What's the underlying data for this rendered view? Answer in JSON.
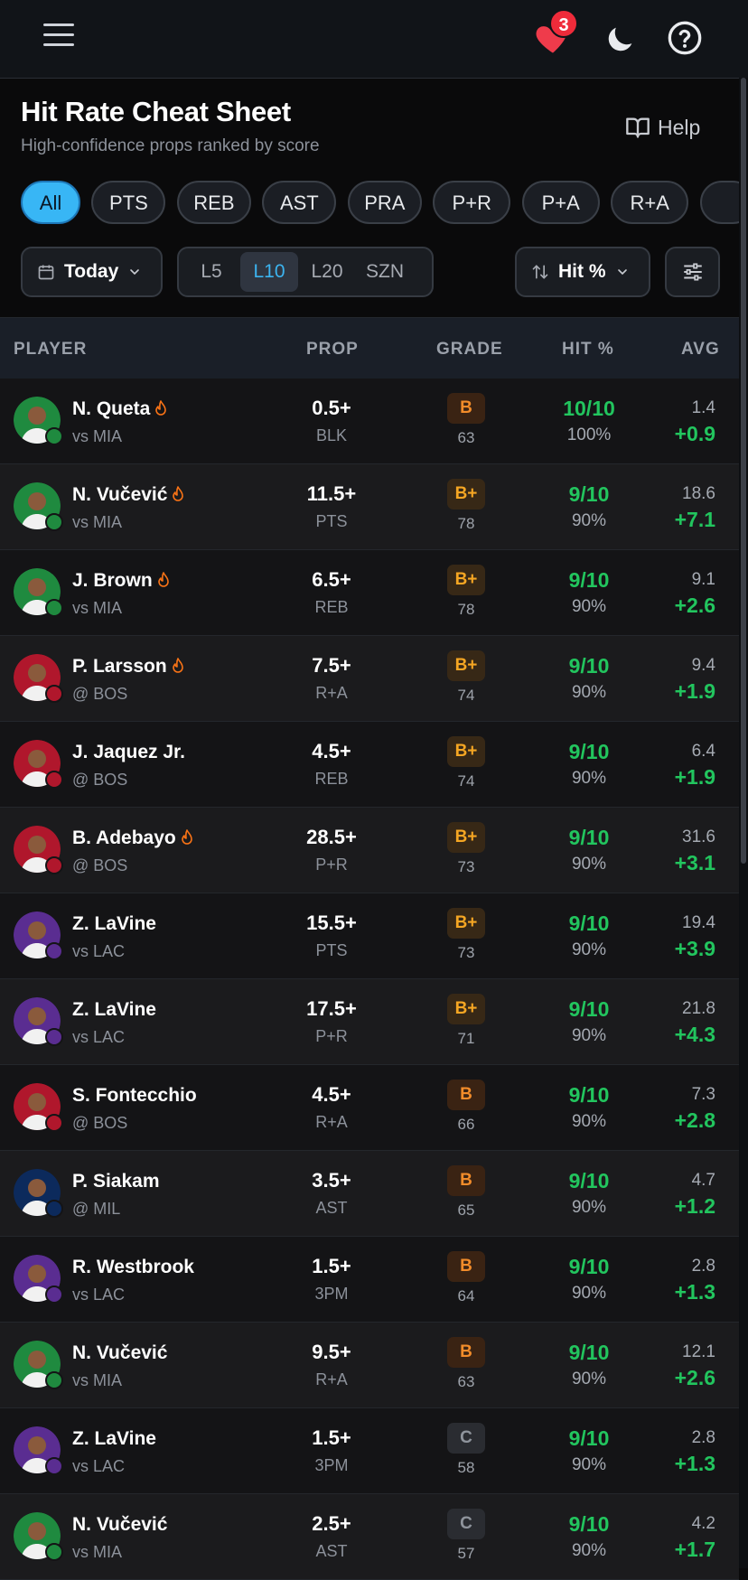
{
  "topbar": {
    "menu_icon": "hamburger-menu-icon",
    "favorites_icon": "heart-icon",
    "favorites_count": "3",
    "theme_icon": "moon-icon",
    "help_icon": "question-circle-icon"
  },
  "header": {
    "title": "Hit Rate Cheat Sheet",
    "subtitle": "High-confidence props ranked by score",
    "help_label": "Help"
  },
  "chips": [
    {
      "label": "All",
      "active": true
    },
    {
      "label": "PTS"
    },
    {
      "label": "REB"
    },
    {
      "label": "AST"
    },
    {
      "label": "PRA"
    },
    {
      "label": "P+R"
    },
    {
      "label": "P+A"
    },
    {
      "label": "R+A"
    }
  ],
  "controls": {
    "date_label": "Today",
    "windows": [
      "L5",
      "L10",
      "L20",
      "SZN"
    ],
    "active_window": "L10",
    "sort_label": "Hit %"
  },
  "table": {
    "headers": {
      "player": "PLAYER",
      "prop": "PROP",
      "grade": "GRADE",
      "hit": "HIT %",
      "avg": "AVG"
    },
    "rows": [
      {
        "name": "N. Queta",
        "hot": true,
        "opp": "vs MIA",
        "line": "0.5+",
        "stat": "BLK",
        "grade": "B",
        "score": "63",
        "hit": "10/10",
        "pct": "100%",
        "avg": "1.4",
        "delta": "+0.9",
        "team": "BOS"
      },
      {
        "name": "N. Vučević",
        "hot": true,
        "opp": "vs MIA",
        "line": "11.5+",
        "stat": "PTS",
        "grade": "B+",
        "score": "78",
        "hit": "9/10",
        "pct": "90%",
        "avg": "18.6",
        "delta": "+7.1",
        "team": "BOS"
      },
      {
        "name": "J. Brown",
        "hot": true,
        "opp": "vs MIA",
        "line": "6.5+",
        "stat": "REB",
        "grade": "B+",
        "score": "78",
        "hit": "9/10",
        "pct": "90%",
        "avg": "9.1",
        "delta": "+2.6",
        "team": "BOS"
      },
      {
        "name": "P. Larsson",
        "hot": true,
        "opp": "@ BOS",
        "line": "7.5+",
        "stat": "R+A",
        "grade": "B+",
        "score": "74",
        "hit": "9/10",
        "pct": "90%",
        "avg": "9.4",
        "delta": "+1.9",
        "team": "MIA"
      },
      {
        "name": "J. Jaquez Jr.",
        "hot": false,
        "opp": "@ BOS",
        "line": "4.5+",
        "stat": "REB",
        "grade": "B+",
        "score": "74",
        "hit": "9/10",
        "pct": "90%",
        "avg": "6.4",
        "delta": "+1.9",
        "team": "MIA"
      },
      {
        "name": "B. Adebayo",
        "hot": true,
        "opp": "@ BOS",
        "line": "28.5+",
        "stat": "P+R",
        "grade": "B+",
        "score": "73",
        "hit": "9/10",
        "pct": "90%",
        "avg": "31.6",
        "delta": "+3.1",
        "team": "MIA"
      },
      {
        "name": "Z. LaVine",
        "hot": false,
        "opp": "vs LAC",
        "line": "15.5+",
        "stat": "PTS",
        "grade": "B+",
        "score": "73",
        "hit": "9/10",
        "pct": "90%",
        "avg": "19.4",
        "delta": "+3.9",
        "team": "SAC"
      },
      {
        "name": "Z. LaVine",
        "hot": false,
        "opp": "vs LAC",
        "line": "17.5+",
        "stat": "P+R",
        "grade": "B+",
        "score": "71",
        "hit": "9/10",
        "pct": "90%",
        "avg": "21.8",
        "delta": "+4.3",
        "team": "SAC"
      },
      {
        "name": "S. Fontecchio",
        "hot": false,
        "opp": "@ BOS",
        "line": "4.5+",
        "stat": "R+A",
        "grade": "B",
        "score": "66",
        "hit": "9/10",
        "pct": "90%",
        "avg": "7.3",
        "delta": "+2.8",
        "team": "MIA"
      },
      {
        "name": "P. Siakam",
        "hot": false,
        "opp": "@ MIL",
        "line": "3.5+",
        "stat": "AST",
        "grade": "B",
        "score": "65",
        "hit": "9/10",
        "pct": "90%",
        "avg": "4.7",
        "delta": "+1.2",
        "team": "IND"
      },
      {
        "name": "R. Westbrook",
        "hot": false,
        "opp": "vs LAC",
        "line": "1.5+",
        "stat": "3PM",
        "grade": "B",
        "score": "64",
        "hit": "9/10",
        "pct": "90%",
        "avg": "2.8",
        "delta": "+1.3",
        "team": "SAC"
      },
      {
        "name": "N. Vučević",
        "hot": false,
        "opp": "vs MIA",
        "line": "9.5+",
        "stat": "R+A",
        "grade": "B",
        "score": "63",
        "hit": "9/10",
        "pct": "90%",
        "avg": "12.1",
        "delta": "+2.6",
        "team": "BOS"
      },
      {
        "name": "Z. LaVine",
        "hot": false,
        "opp": "vs LAC",
        "line": "1.5+",
        "stat": "3PM",
        "grade": "C",
        "score": "58",
        "hit": "9/10",
        "pct": "90%",
        "avg": "2.8",
        "delta": "+1.3",
        "team": "SAC"
      },
      {
        "name": "N. Vučević",
        "hot": false,
        "opp": "vs MIA",
        "line": "2.5+",
        "stat": "AST",
        "grade": "C",
        "score": "57",
        "hit": "9/10",
        "pct": "90%",
        "avg": "4.2",
        "delta": "+1.7",
        "team": "BOS"
      }
    ]
  },
  "colors": {
    "accent": "#38b6f5",
    "positive": "#22c55e",
    "grade_b": "#f28c2a",
    "grade_b_plus": "#f5a623",
    "grade_c": "#8f949c",
    "hot": "#f97316",
    "team_BOS": "#1f8a3f",
    "team_MIA": "#b0172c",
    "team_SAC": "#5a2d91",
    "team_IND": "#0c2a5c"
  }
}
